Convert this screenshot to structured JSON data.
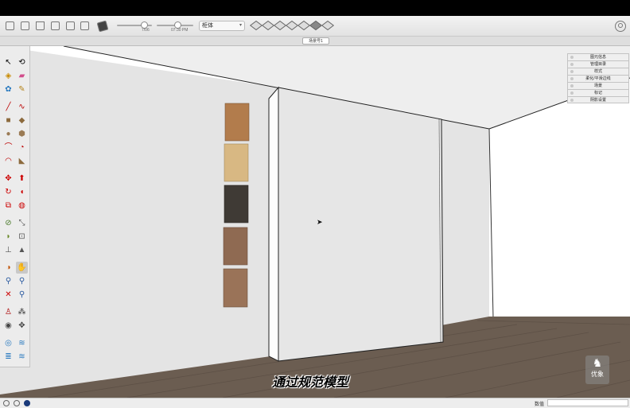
{
  "toolbar": {
    "slider1_label": "7/06",
    "slider2_label": "07:30 PM",
    "style_value": "柜体"
  },
  "scene_tab": "场景号1",
  "trays": [
    "图元信息",
    "管理目录",
    "样式",
    "柔化/平滑边线",
    "场景",
    "标记",
    "阴影设置"
  ],
  "subtitle": "通过规范模型",
  "watermark": "优象",
  "status": {
    "measurements_label": "数值",
    "measurements_value": ""
  },
  "colors": {
    "floor": "#6b5d51",
    "wall": "#e3e3e3",
    "sky": "#ffffff",
    "swatches": [
      "#b27c4c",
      "#d8b883",
      "#3f3a35",
      "#8f6a52",
      "#9a7358"
    ]
  },
  "icons": {
    "palette": [
      "select",
      "orbit",
      "paint-bucket",
      "eraser",
      "tape",
      "pencil",
      "line",
      "freehand",
      "rectangle",
      "rotated-rectangle",
      "circle",
      "polygon",
      "arc",
      "pie",
      "arc-3pt",
      "arc-2pt",
      "move",
      "push-pull",
      "rotate",
      "follow-me",
      "scale",
      "offset",
      "tape-measure",
      "dimension",
      "protractor",
      "text",
      "axes",
      "3d-text",
      "section",
      "walk",
      "zoom",
      "zoom-window",
      "zoom-extents",
      "position-camera",
      "look-around",
      "footprints",
      "sandbox-smoove",
      "sandbox-stamp",
      "add-location",
      "drape"
    ]
  }
}
